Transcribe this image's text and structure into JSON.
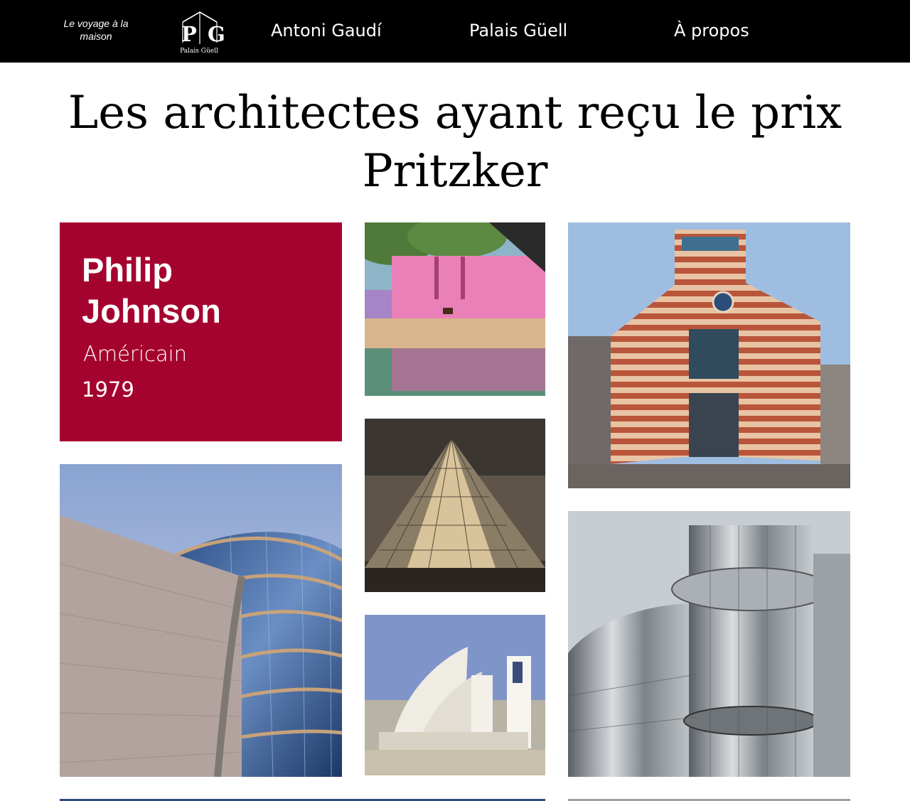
{
  "nav": {
    "tagline": "Le voyage à la maison",
    "logo": {
      "letters": "P G",
      "caption": "Palais Güell",
      "icon": "house-outline-icon"
    },
    "links": [
      "Antoni Gaudí",
      "Palais Güell",
      "À propos"
    ]
  },
  "page": {
    "title_line1": "Les architectes ayant reçu le prix",
    "title_line2": "Pritzker"
  },
  "card": {
    "name_line1": "Philip",
    "name_line2": "Johnson",
    "nationality": "Américain",
    "year": "1979",
    "color": "#a5032f"
  },
  "gallery": [
    "pink-wall-with-horse-photo",
    "glass-pyramid-night-photo",
    "white-sail-church-photo",
    "striped-postmodern-building-photo",
    "curved-glass-convention-centre-photo",
    "mirrored-glass-tower-photo"
  ]
}
